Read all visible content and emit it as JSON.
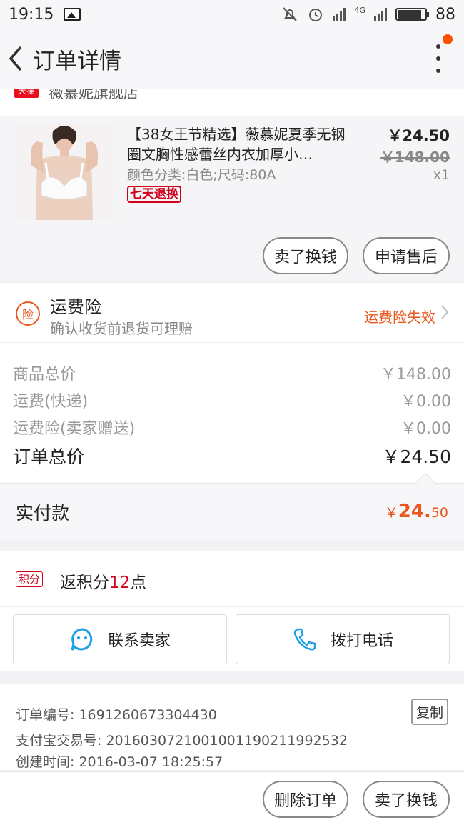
{
  "status_bar": {
    "time": "19:15",
    "network": "4G",
    "battery": "88"
  },
  "nav": {
    "title": "订单详情"
  },
  "shop": {
    "badge": "天猫",
    "name": "薇慕妮旗舰店"
  },
  "product": {
    "title": "【38女王节精选】薇慕妮夏季无钢圈文胸性感蕾丝内衣加厚小…",
    "spec": "颜色分类:白色;尺码:80A",
    "tag": "七天退换",
    "price": "￥24.50",
    "original_price": "￥148.00",
    "quantity": "x1",
    "buttons": {
      "sell": "卖了换钱",
      "after_sale": "申请售后"
    }
  },
  "insurance": {
    "icon_text": "险",
    "title": "运费险",
    "subtitle": "确认收货前退货可理赔",
    "status": "运费险失效"
  },
  "costs": [
    {
      "label": "商品总价",
      "value": "￥148.00"
    },
    {
      "label": "运费(快递)",
      "value": "￥0.00"
    },
    {
      "label": "运费险(卖家赠送)",
      "value": "￥0.00"
    },
    {
      "label": "订单总价",
      "value": "￥24.50"
    }
  ],
  "paid": {
    "label": "实付款",
    "currency": "￥",
    "integer": "24.",
    "decimal": "50"
  },
  "points": {
    "tag": "积分",
    "prefix": "返积分",
    "number": "12",
    "suffix": "点"
  },
  "contact": {
    "seller": "联系卖家",
    "phone": "拨打电话"
  },
  "info": {
    "order_no": "订单编号: 1691260673304430",
    "alipay_no": "支付宝交易号: 2016030721001001190211992532",
    "created": "创建时间: 2016-03-07 18:25:57",
    "copy": "复制"
  },
  "bottom": {
    "delete": "删除订单",
    "sell": "卖了换钱"
  },
  "colors": {
    "accent": "#e8581e",
    "red": "#d0021b",
    "tmall": "#e8101e"
  }
}
